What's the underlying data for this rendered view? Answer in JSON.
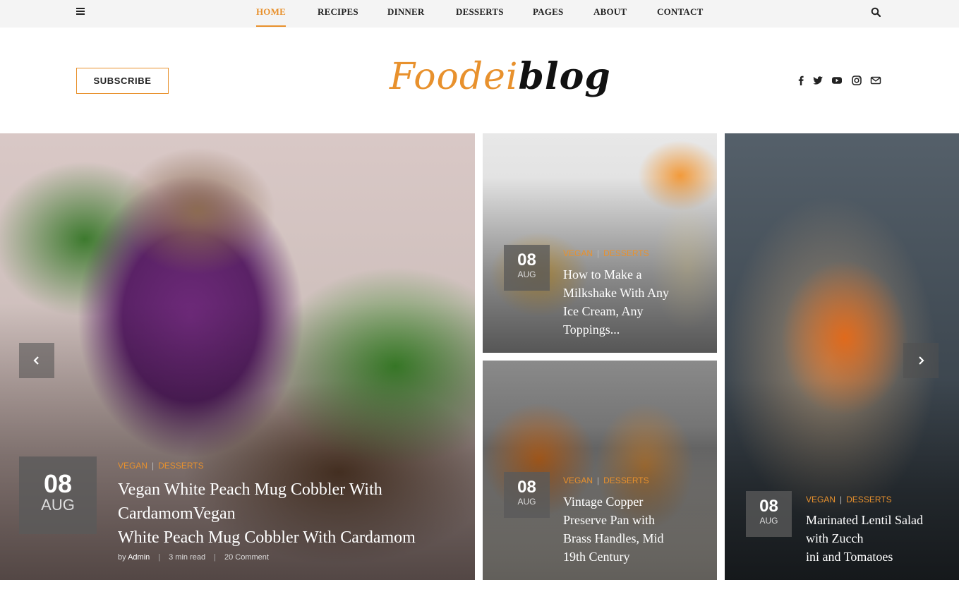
{
  "nav": {
    "items": [
      "HOME",
      "RECIPES",
      "DINNER",
      "DESSERTS",
      "PAGES",
      "ABOUT",
      "CONTACT"
    ],
    "active": "HOME",
    "accent_color": "#e8912d"
  },
  "header": {
    "subscribe_label": "SUBSCRIBE",
    "logo_part1": "Foodei",
    "logo_part2": "blog",
    "social_icons": [
      "facebook-icon",
      "twitter-icon",
      "youtube-icon",
      "instagram-icon",
      "email-icon"
    ]
  },
  "posts": [
    {
      "day": "08",
      "month": "AUG",
      "categories": [
        "VEGAN",
        "DESSERTS"
      ],
      "title_line1": "Vegan White Peach Mug Cobbler With",
      "title_line2": "CardamomVegan",
      "title_line3": "White Peach Mug Cobbler With Cardamom",
      "meta_by": "by",
      "meta_author": "Admin",
      "meta_read": "3 min read",
      "meta_comments": "20 Comment"
    },
    {
      "day": "08",
      "month": "AUG",
      "categories": [
        "VEGAN",
        "DESSERTS"
      ],
      "title_line1": "How to Make a",
      "title_line2": "Milkshake With Any",
      "title_line3": "Ice Cream, Any",
      "title_line4": "Toppings..."
    },
    {
      "day": "08",
      "month": "AUG",
      "categories": [
        "VEGAN",
        "DESSERTS"
      ],
      "title_line1": "Vintage Copper",
      "title_line2": "Preserve Pan with",
      "title_line3": "Brass Handles, Mid",
      "title_line4": "19th Century"
    },
    {
      "day": "08",
      "month": "AUG",
      "categories": [
        "VEGAN",
        "DESSERTS"
      ],
      "title_line1": "Marinated Lentil Salad",
      "title_line2": "with Zucch",
      "title_line3": "ini and Tomatoes"
    }
  ],
  "slider": {
    "prev_icon": "chevron-left-icon",
    "next_icon": "chevron-right-icon"
  }
}
